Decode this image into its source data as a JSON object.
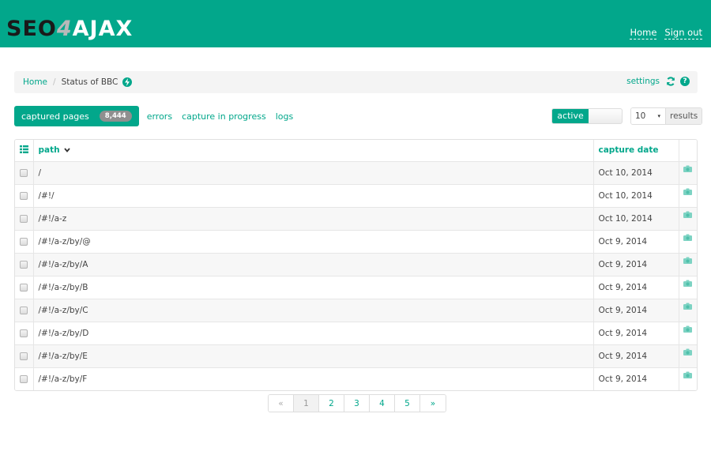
{
  "brand": {
    "part1": "SE▣",
    "part2": "4",
    "part3": "AJAX",
    "full": "SEO4AJAX",
    "accent": "#02a78b"
  },
  "nav": {
    "links": [
      {
        "label": "Home"
      },
      {
        "label": "Sign out"
      }
    ]
  },
  "breadcrumb": {
    "home": "Home",
    "separator": "/",
    "current": "Status of BBC",
    "status_icon": "bolt-icon",
    "settings_label": "settings",
    "refresh_icon": "refresh-icon",
    "help_icon": "help-icon",
    "help_glyph": "?"
  },
  "tabs": {
    "captured_label": "captured pages",
    "captured_count": "8,444",
    "errors_label": "errors",
    "progress_label": "capture in progress",
    "logs_label": "logs"
  },
  "toggle": {
    "label": "active",
    "state": "on"
  },
  "results": {
    "value": "10",
    "caret": "▾",
    "addon": "results"
  },
  "table": {
    "columns": {
      "path": "path",
      "path_sort": "⌄",
      "date": "capture date"
    },
    "rows": [
      {
        "path": "/",
        "date": "Oct 10, 2014"
      },
      {
        "path": "/#!/",
        "date": "Oct 10, 2014"
      },
      {
        "path": "/#!/a-z",
        "date": "Oct 10, 2014"
      },
      {
        "path": "/#!/a-z/by/@",
        "date": "Oct 9, 2014"
      },
      {
        "path": "/#!/a-z/by/A",
        "date": "Oct 9, 2014"
      },
      {
        "path": "/#!/a-z/by/B",
        "date": "Oct 9, 2014"
      },
      {
        "path": "/#!/a-z/by/C",
        "date": "Oct 9, 2014"
      },
      {
        "path": "/#!/a-z/by/D",
        "date": "Oct 9, 2014"
      },
      {
        "path": "/#!/a-z/by/E",
        "date": "Oct 9, 2014"
      },
      {
        "path": "/#!/a-z/by/F",
        "date": "Oct 9, 2014"
      }
    ]
  },
  "pagination": {
    "prev": "«",
    "pages": [
      "1",
      "2",
      "3",
      "4",
      "5"
    ],
    "current": "1",
    "next": "»"
  }
}
